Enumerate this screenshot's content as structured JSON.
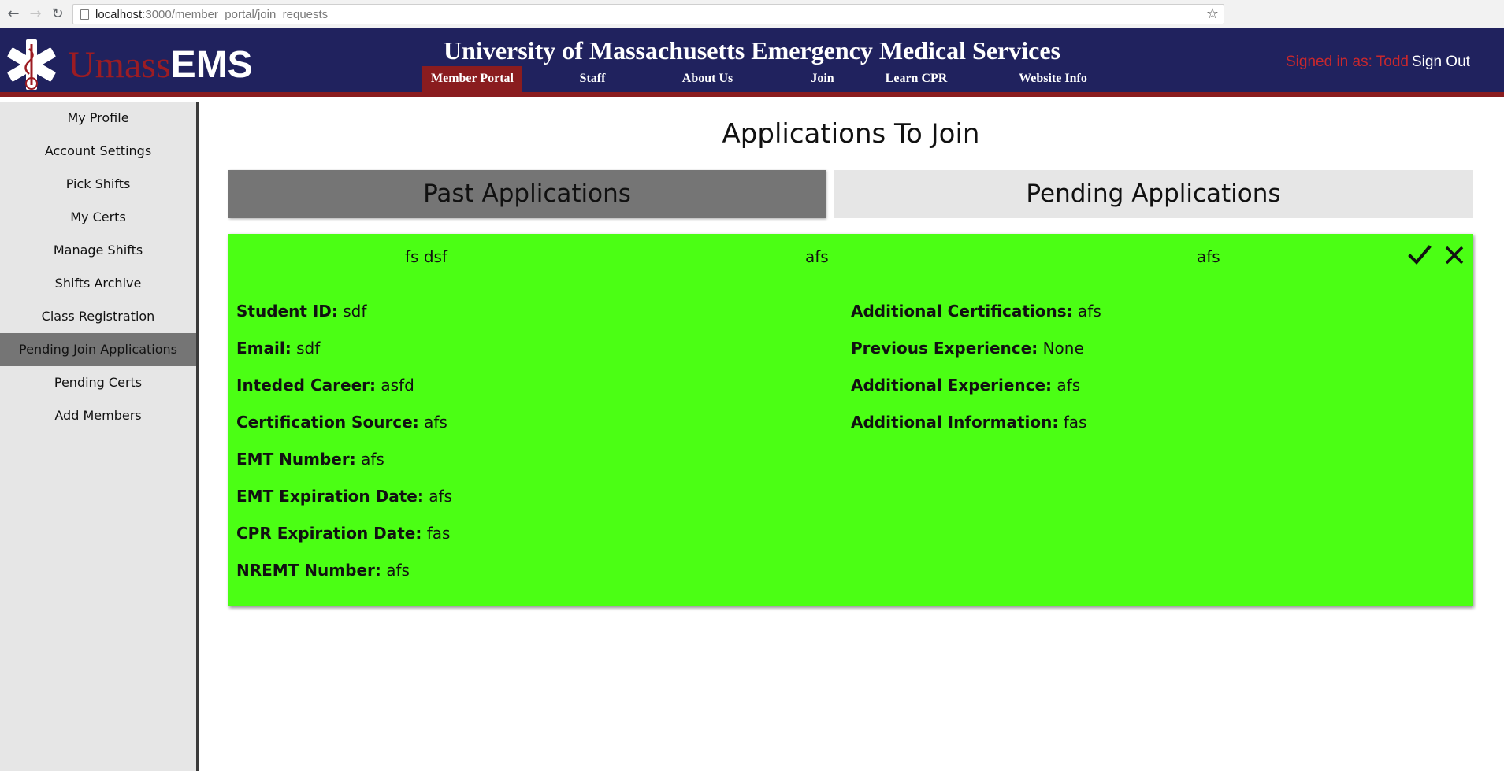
{
  "browser": {
    "url_host": "localhost",
    "url_path": ":3000/member_portal/join_requests",
    "back_icon": "back-arrow-icon",
    "forward_icon": "forward-arrow-icon",
    "reload_icon": "reload-icon",
    "bookmark_icon": "star-icon"
  },
  "header": {
    "logo_umass": "Umass",
    "logo_ems": "EMS",
    "title": "University of Massachusetts Emergency Medical Services",
    "nav": [
      {
        "label": "Member Portal",
        "active": true
      },
      {
        "label": "Staff"
      },
      {
        "label": "About Us"
      },
      {
        "label": "Join"
      },
      {
        "label": "Learn CPR"
      },
      {
        "label": "Website Info"
      }
    ],
    "signed_in": "Signed in as: Todd",
    "sign_out": "Sign Out",
    "colors": {
      "bar": "#20225e",
      "accent": "#8a1c1f",
      "signed_in": "#c9282d"
    }
  },
  "sidebar": {
    "items": [
      {
        "label": "My Profile"
      },
      {
        "label": "Account Settings"
      },
      {
        "label": "Pick Shifts"
      },
      {
        "label": "My Certs"
      },
      {
        "label": "Manage Shifts"
      },
      {
        "label": "Shifts Archive"
      },
      {
        "label": "Class Registration"
      },
      {
        "label": "Pending Join Applications",
        "active": true
      },
      {
        "label": "Pending Certs"
      },
      {
        "label": "Add Members"
      }
    ]
  },
  "main": {
    "title": "Applications To Join",
    "tabs": [
      {
        "label": "Past Applications",
        "selected": true
      },
      {
        "label": "Pending Applications"
      }
    ],
    "application": {
      "card_color": "#4bff14",
      "name": "fs dsf",
      "col2": "afs",
      "col3": "afs",
      "approve_icon": "check-icon",
      "reject_icon": "close-icon",
      "left_fields": [
        {
          "label": "Student ID:",
          "value": "sdf"
        },
        {
          "label": "Email:",
          "value": "sdf"
        },
        {
          "label": "Inteded Career:",
          "value": "asfd"
        },
        {
          "label": "Certification Source:",
          "value": "afs"
        },
        {
          "label": "EMT Number:",
          "value": "afs"
        },
        {
          "label": "EMT Expiration Date:",
          "value": "afs"
        },
        {
          "label": "CPR Expiration Date:",
          "value": "fas"
        },
        {
          "label": "NREMT Number:",
          "value": "afs"
        }
      ],
      "right_fields": [
        {
          "label": "Additional Certifications:",
          "value": "afs"
        },
        {
          "label": "Previous Experience:",
          "value": "None"
        },
        {
          "label": "Additional Experience:",
          "value": "afs"
        },
        {
          "label": "Additional Information:",
          "value": "fas"
        }
      ]
    }
  }
}
